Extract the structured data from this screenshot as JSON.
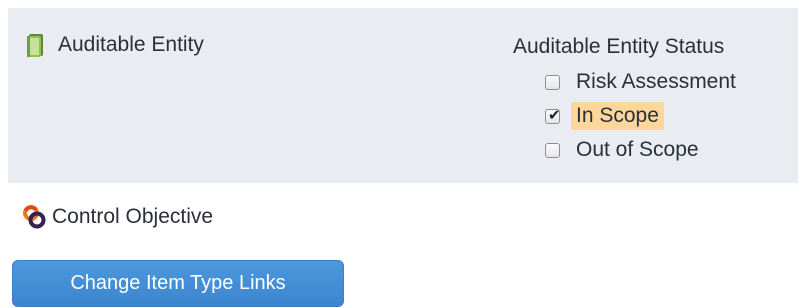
{
  "auditable_entity": {
    "icon": "book-icon",
    "label": "Auditable Entity"
  },
  "status": {
    "title": "Auditable Entity Status",
    "options": [
      {
        "label": "Risk Assessment",
        "checked": false,
        "highlighted": false
      },
      {
        "label": "In Scope",
        "checked": true,
        "highlighted": true
      },
      {
        "label": "Out of Scope",
        "checked": false,
        "highlighted": false
      }
    ]
  },
  "linked_item": {
    "icon": "control-objective-icon",
    "label": "Control Objective"
  },
  "button": {
    "label": "Change Item Type Links"
  },
  "colors": {
    "panel_background": "#e9edf1",
    "highlight": "#fcd79c",
    "button_background": "#4290d6",
    "text": "#2b2f38"
  }
}
